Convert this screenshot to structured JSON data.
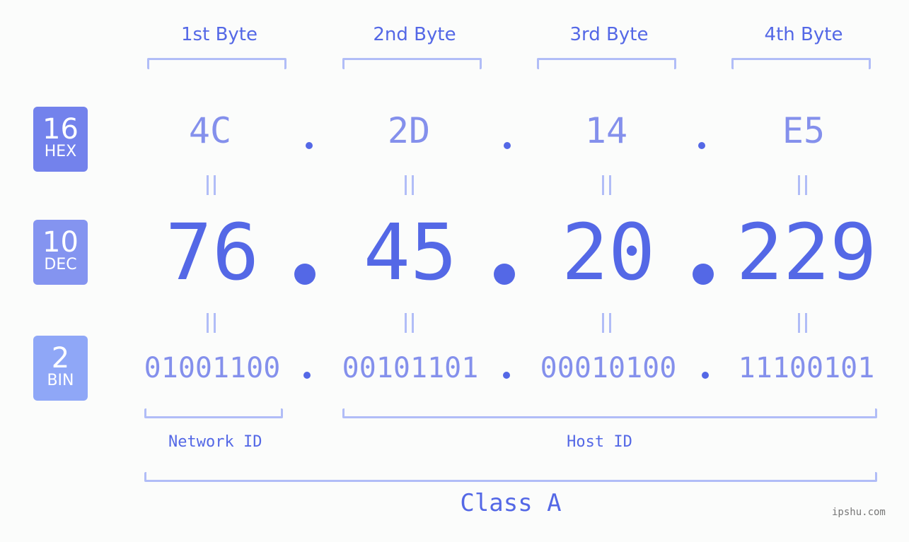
{
  "bytes": [
    {
      "label": "1st Byte",
      "hex": "4C",
      "dec": "76",
      "bin": "01001100"
    },
    {
      "label": "2nd Byte",
      "hex": "2D",
      "dec": "45",
      "bin": "00101101"
    },
    {
      "label": "3rd Byte",
      "hex": "14",
      "dec": "20",
      "bin": "00010100"
    },
    {
      "label": "4th Byte",
      "hex": "E5",
      "dec": "229",
      "bin": "11100101"
    }
  ],
  "badges": {
    "hex": {
      "num": "16",
      "label": "HEX",
      "color": "#7382ec"
    },
    "dec": {
      "num": "10",
      "label": "DEC",
      "color": "#8494f0"
    },
    "bin": {
      "num": "2",
      "label": "BIN",
      "color": "#8fa7f7"
    }
  },
  "equals_symbol": "=",
  "network_id_label": "Network ID",
  "host_id_label": "Host ID",
  "class_label": "Class A",
  "watermark": "ipshu.com",
  "colors": {
    "primary": "#5468e6",
    "secondary": "#8490ec",
    "bracket": "#b1bdf7",
    "background": "#fbfcfb"
  }
}
